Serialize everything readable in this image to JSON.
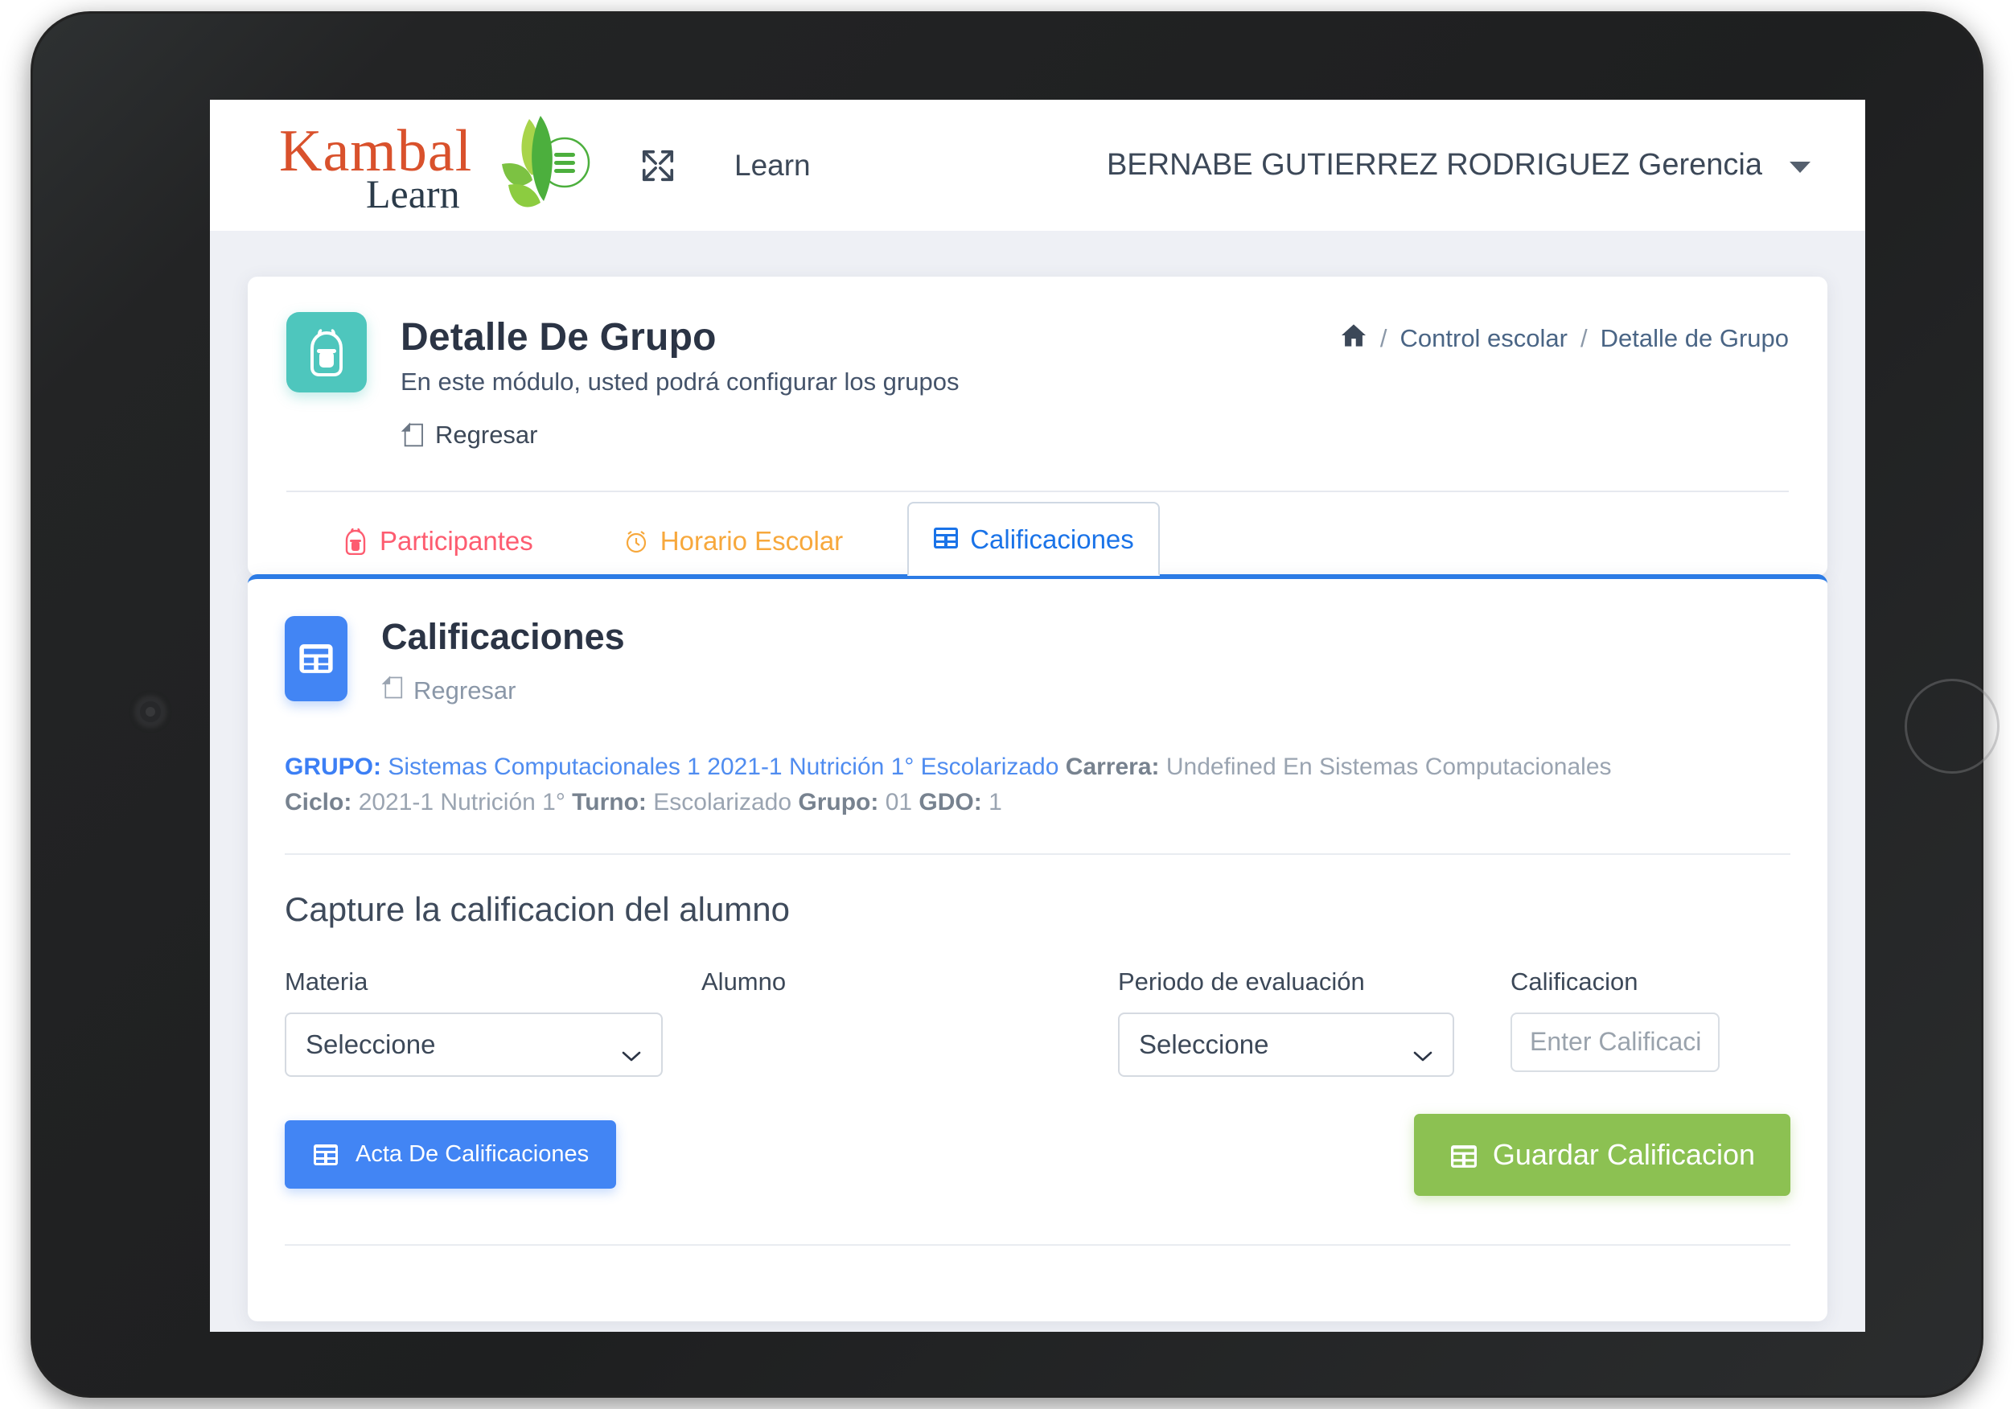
{
  "brand": {
    "name_primary": "Kambal",
    "name_secondary": "Learn",
    "logo_colors": {
      "primary": "#d9512c",
      "secondary": "#2b3b4a",
      "leaf_dark": "#4caf3d",
      "leaf_light": "#a8d44a"
    }
  },
  "header": {
    "fullscreen_icon": "expand-arrows-icon",
    "nav_link": "Learn",
    "user_name": "BERNABE GUTIERREZ RODRIGUEZ Gerencia",
    "caret_icon": "chevron-down-icon"
  },
  "module": {
    "icon": "backpack-icon",
    "icon_color": "#4ec6bd",
    "title": "Detalle De Grupo",
    "subtitle": "En este módulo, usted podrá configurar los grupos",
    "back_label": "Regresar",
    "back_icon": "back-page-icon"
  },
  "breadcrumb": {
    "home_icon": "home-icon",
    "separator": "/",
    "items": [
      {
        "label": "Control escolar"
      },
      {
        "label": "Detalle de Grupo"
      }
    ]
  },
  "tabs": [
    {
      "label": "Participantes",
      "icon": "backpack-icon",
      "color": "#fd5c70",
      "active": false
    },
    {
      "label": "Horario Escolar",
      "icon": "alarm-clock-icon",
      "color": "#f7a83c",
      "active": false
    },
    {
      "label": "Calificaciones",
      "icon": "table-grid-icon",
      "color": "#1a73e8",
      "active": true
    }
  ],
  "grades_card": {
    "icon": "table-grid-icon",
    "icon_color": "#4285f4",
    "title": "Calificaciones",
    "back_label": "Regresar",
    "back_icon": "back-page-icon",
    "accent_color": "#2c7be5",
    "group_info": {
      "grupo_label": "GRUPO:",
      "grupo_value": "Sistemas Computacionales 1 2021-1 Nutrición 1° Escolarizado",
      "carrera_label": "Carrera:",
      "carrera_value": "Undefined En Sistemas Computacionales",
      "ciclo_label": "Ciclo:",
      "ciclo_value": "2021-1 Nutrición 1°",
      "turno_label": "Turno:",
      "turno_value": "Escolarizado",
      "grupo2_label": "Grupo:",
      "grupo2_value": "01",
      "gdo_label": "GDO:",
      "gdo_value": "1"
    },
    "capture_title": "Capture la calificacion del alumno",
    "fields": {
      "materia_label": "Materia",
      "materia_value": "Seleccione",
      "alumno_label": "Alumno",
      "periodo_label": "Periodo de evaluación",
      "periodo_value": "Seleccione",
      "calificacion_label": "Calificacion",
      "calificacion_value": "",
      "calificacion_placeholder": "Enter Calificacio"
    },
    "buttons": {
      "acta_label": "Acta De Calificaciones",
      "acta_icon": "table-grid-icon",
      "acta_color": "#4285f4",
      "guardar_label": "Guardar Calificacion",
      "guardar_icon": "table-grid-icon",
      "guardar_color": "#8cc152"
    }
  },
  "device": {
    "camera_icon": "camera-lens",
    "home_button": "home-button"
  }
}
